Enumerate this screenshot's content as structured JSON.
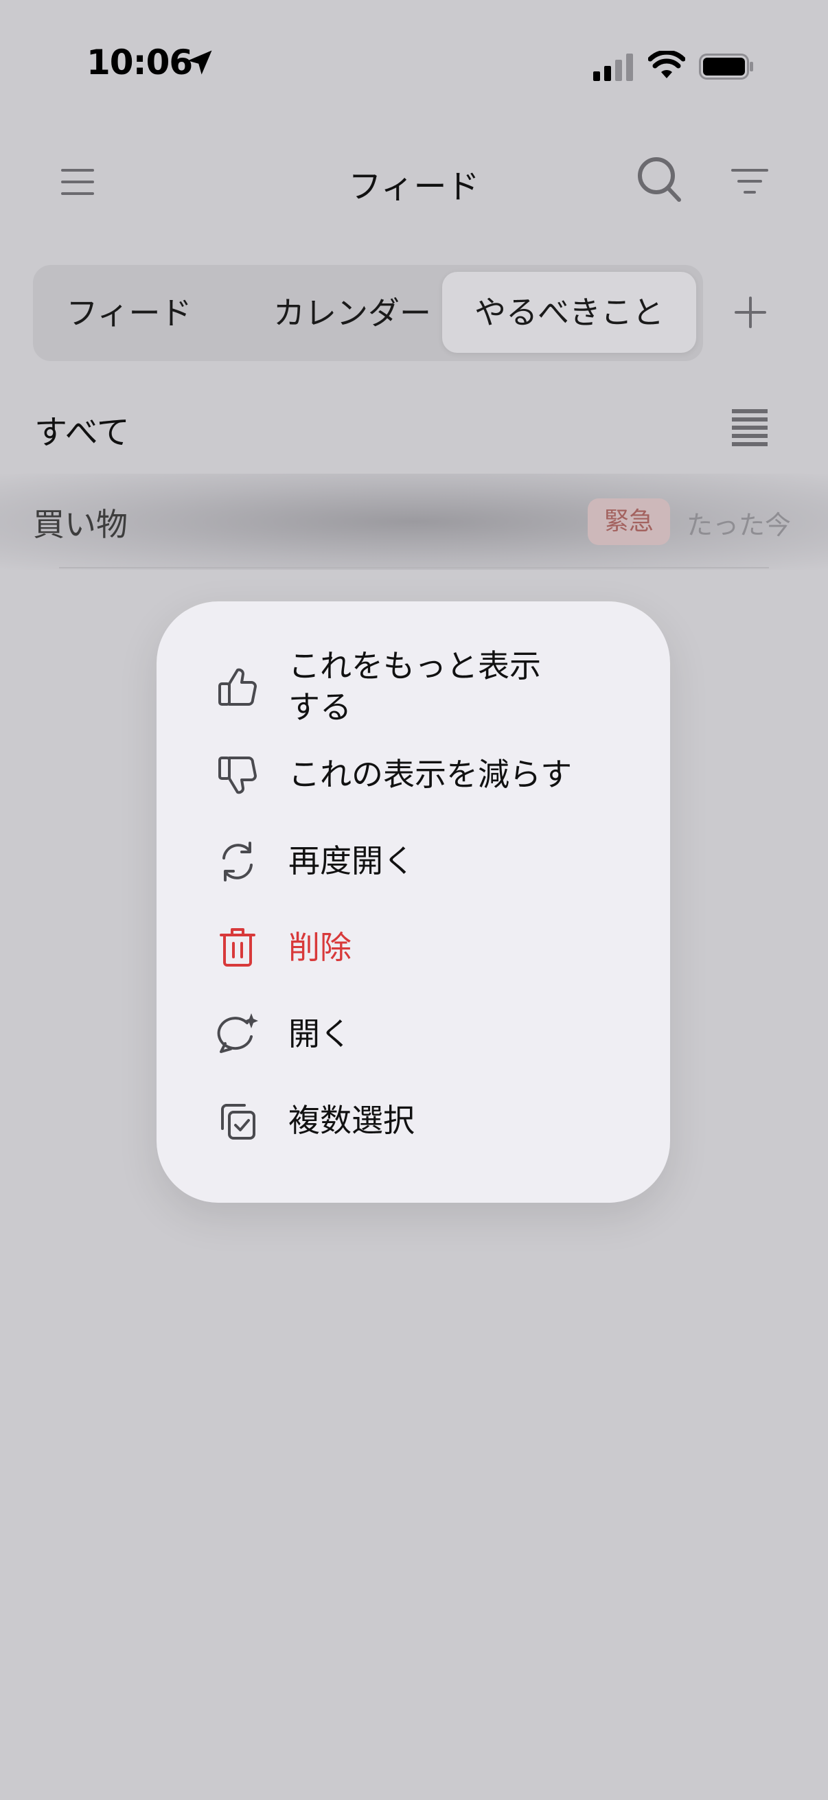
{
  "status_bar": {
    "time": "10:06"
  },
  "nav": {
    "title": "フィード"
  },
  "tabs": [
    {
      "label": "フィード"
    },
    {
      "label": "カレンダー"
    },
    {
      "label": "やるべきこと",
      "selected": true
    }
  ],
  "list": {
    "header": "すべて",
    "rows": [
      {
        "title": "買い物",
        "badge": "緊急",
        "time": "たった今"
      }
    ]
  },
  "context_menu": {
    "items": [
      {
        "label": "これをもっと表示\nする",
        "icon": "thumbs-up-icon"
      },
      {
        "label": "これの表示を減らす",
        "icon": "thumbs-down-icon"
      },
      {
        "label": "再度開く",
        "icon": "refresh-icon"
      },
      {
        "label": "削除",
        "icon": "trash-icon",
        "destructive": true
      },
      {
        "label": "開く",
        "icon": "chat-sparkle-icon"
      },
      {
        "label": "複数選択",
        "icon": "multi-select-icon"
      }
    ]
  },
  "colors": {
    "background": "#cbcace",
    "menu_background": "#efeef3",
    "destructive": "#d8393a",
    "badge_text": "#a3625f",
    "badge_background": "#cdb8ba"
  }
}
